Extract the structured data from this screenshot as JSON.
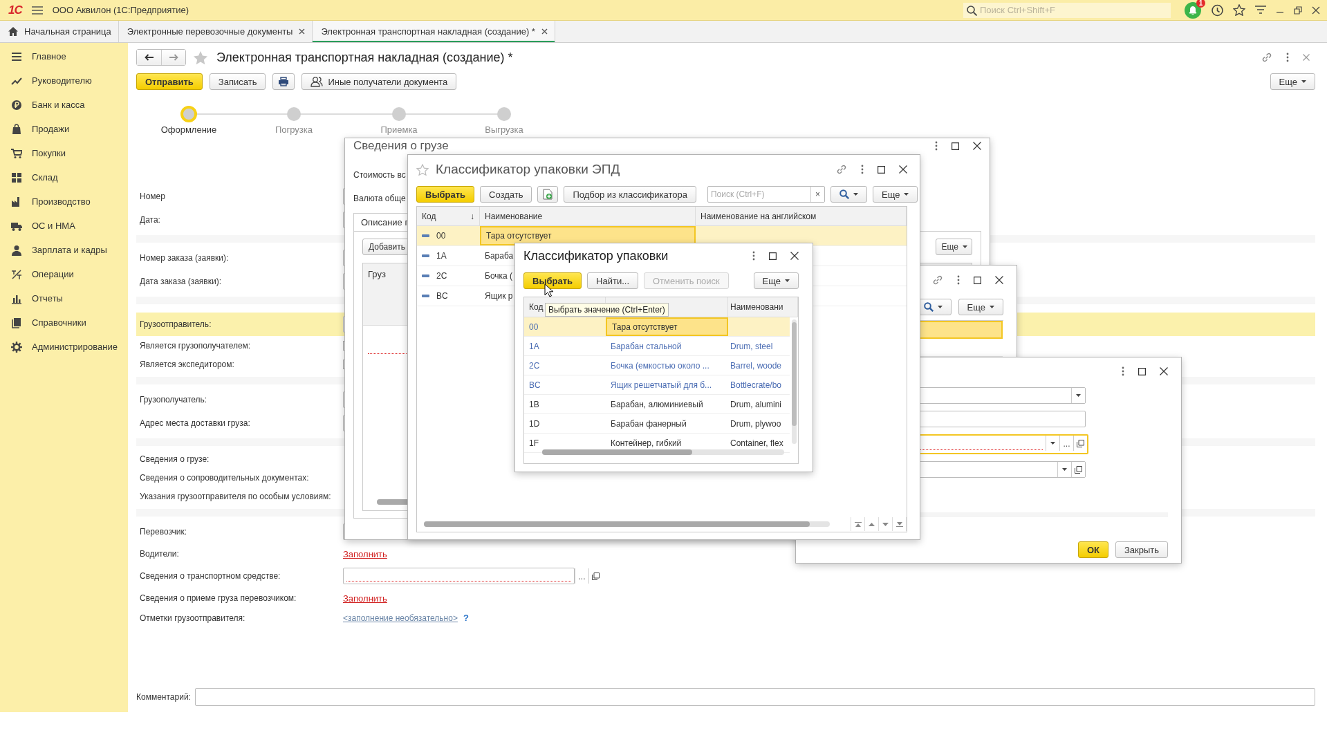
{
  "app_bar": {
    "logo": "1С",
    "title": "ООО Аквилон  (1С:Предприятие)",
    "search": {
      "placeholder": "Поиск Ctrl+Shift+F"
    },
    "notifications": "1"
  },
  "tabs": [
    {
      "label": "Начальная страница",
      "kind": "home",
      "selected": false
    },
    {
      "label": "Электронные перевозочные документы",
      "kind": "closable",
      "selected": false
    },
    {
      "label": "Электронная транспортная накладная (создание) *",
      "kind": "closable",
      "selected": true
    }
  ],
  "sidebar": {
    "items": [
      {
        "label": "Главное"
      },
      {
        "label": "Руководителю"
      },
      {
        "label": "Банк и касса"
      },
      {
        "label": "Продажи"
      },
      {
        "label": "Покупки"
      },
      {
        "label": "Склад"
      },
      {
        "label": "Производство"
      },
      {
        "label": "ОС и НМА"
      },
      {
        "label": "Зарплата и кадры"
      },
      {
        "label": "Операции"
      },
      {
        "label": "Отчеты"
      },
      {
        "label": "Справочники"
      },
      {
        "label": "Администрирование"
      }
    ]
  },
  "form": {
    "title": "Электронная транспортная накладная (создание) *",
    "buttons": [
      {
        "label": "Отправить",
        "kind": "primary"
      },
      {
        "label": "Записать",
        "kind": "plain"
      },
      {
        "kind": "print"
      },
      {
        "label": "Иные получатели документа",
        "kind": "recipients"
      }
    ],
    "more": "Еще",
    "steps": [
      {
        "label": "Оформление",
        "selected": true
      },
      {
        "label": "Погрузка",
        "selected": false
      },
      {
        "label": "Приемка",
        "selected": false
      },
      {
        "label": "Выгрузка",
        "selected": false
      }
    ],
    "sections": [
      {
        "rows": [
          {
            "label": "Номер",
            "kind": "input",
            "selected": false
          },
          {
            "label": "Дата:",
            "kind": "input",
            "selected": false
          }
        ]
      },
      {
        "rows": [
          {
            "label": "Номер заказа (заявки):",
            "kind": "input",
            "selected": false
          },
          {
            "label": "Дата заказа (заявки):",
            "kind": "input",
            "selected": false
          }
        ]
      },
      {
        "rows": [
          {
            "label": "Грузоотправитель:",
            "kind": "input",
            "selected": true
          },
          {
            "label": "Является грузополучателем:",
            "kind": "checkbox",
            "selected": false
          },
          {
            "label": "Является экспедитором:",
            "kind": "checkbox",
            "selected": false
          }
        ]
      },
      {
        "rows": [
          {
            "label": "Грузополучатель:",
            "kind": "input",
            "selected": false
          },
          {
            "label": "Адрес места доставки груза:",
            "kind": "input",
            "selected": false
          }
        ]
      },
      {
        "rows": [
          {
            "label": "Сведения о грузе:",
            "kind": "text",
            "selected": false
          },
          {
            "label": "Сведения о сопроводительных документах:",
            "kind": "text",
            "selected": false
          },
          {
            "label": "Указания грузоотправителя по особым условиям:",
            "kind": "text",
            "selected": false
          }
        ]
      },
      {
        "rows": [
          {
            "label": "Перевозчик:",
            "kind": "input",
            "selected": false
          },
          {
            "label": "Водители:",
            "kind": "link",
            "value": "Заполнить",
            "selected": false
          },
          {
            "label": "Сведения о транспортном средстве:",
            "kind": "select",
            "choose": "...",
            "required": true,
            "selected": false
          },
          {
            "label": "Сведения о приеме груза перевозчиком:",
            "kind": "link",
            "value": "Заполнить",
            "selected": false
          },
          {
            "label": "Отметки грузоотправителя:",
            "kind": "optional",
            "value": "<заполнение необязательно>",
            "help": "?",
            "selected": false
          }
        ]
      }
    ],
    "comment": {
      "label": "Комментарий:"
    }
  },
  "cargo_dialog": {
    "title": "Сведения о грузе",
    "fields": [
      "Стоимость вс",
      "Валюта обще"
    ],
    "tab": "Описание г",
    "add": "Добавить",
    "more": "Еще",
    "column": "Груз"
  },
  "third_dialog": {
    "more": "Еще",
    "rows": [
      {
        "selected": true
      },
      {
        "selected": false
      }
    ]
  },
  "fourth_dialog": {
    "fields": [
      {
        "kind": "dropdown",
        "required": false,
        "selected": false
      },
      {
        "kind": "plain",
        "required": false,
        "selected": false
      },
      {
        "kind": "lookup",
        "choose": "...",
        "required": true,
        "selected": true
      },
      {
        "kind": "dropdown-open",
        "required": false,
        "selected": false
      }
    ],
    "buttons": [
      {
        "label": "ОК",
        "kind": "primary"
      },
      {
        "label": "Закрыть",
        "kind": "plain"
      }
    ]
  },
  "epd_dialog": {
    "title": "Классификатор упаковки ЭПД",
    "buttons": [
      {
        "label": "Выбрать",
        "kind": "primary"
      },
      {
        "label": "Создать",
        "kind": "plain"
      },
      {
        "kind": "add"
      },
      {
        "label": "Подбор из классификатора",
        "kind": "plain"
      }
    ],
    "search": {
      "placeholder": "Поиск (Ctrl+F)",
      "clear": "×"
    },
    "more": "Еще",
    "columns": [
      {
        "label": "Код",
        "sort": "↓"
      },
      {
        "label": "Наименование"
      },
      {
        "label": "Наименование на английском"
      }
    ],
    "rows": [
      {
        "code": "00",
        "name": "Тара отсутствует",
        "selected": true
      },
      {
        "code": "1A",
        "name": "Бараба",
        "selected": false
      },
      {
        "code": "2C",
        "name": "Бочка (",
        "selected": false
      },
      {
        "code": "BC",
        "name": "Ящик р",
        "selected": false
      }
    ]
  },
  "package_dialog": {
    "title": "Классификатор упаковки",
    "buttons": [
      {
        "label": "Выбрать",
        "kind": "primary",
        "disabled": false
      },
      {
        "label": "Найти...",
        "kind": "plain",
        "disabled": false
      },
      {
        "label": "Отменить поиск",
        "kind": "plain",
        "disabled": true
      }
    ],
    "more": "Еще",
    "columns": {
      "code": "Код",
      "english": "Наименовани"
    },
    "tooltip": "Выбрать значение (Ctrl+Enter)",
    "rows": [
      {
        "code": "00",
        "name": "Тара отсутствует",
        "color": "#4a6cb3",
        "selected": true
      },
      {
        "code": "1A",
        "name": "Барабан стальной",
        "english": "Drum, steel",
        "color": "#4a6cb3",
        "selected": false
      },
      {
        "code": "2C",
        "name": "Бочка (емкостью около ...",
        "english": "Barrel, woode",
        "color": "#4a6cb3",
        "selected": false
      },
      {
        "code": "BC",
        "name": "Ящик решетчатый для б...",
        "english": "Bottlecrate/bo",
        "color": "#4a6cb3",
        "selected": false
      },
      {
        "code": "1B",
        "name": "Барабан, алюминиевый",
        "english": "Drum, alumini",
        "color": "#333333",
        "selected": false
      },
      {
        "code": "1D",
        "name": "Барабан фанерный",
        "english": "Drum, plywoo",
        "color": "#333333",
        "selected": false
      },
      {
        "code": "1F",
        "name": "Контейнер, гибкий",
        "english": "Container, flex",
        "color": "#333333",
        "selected": false
      }
    ]
  }
}
